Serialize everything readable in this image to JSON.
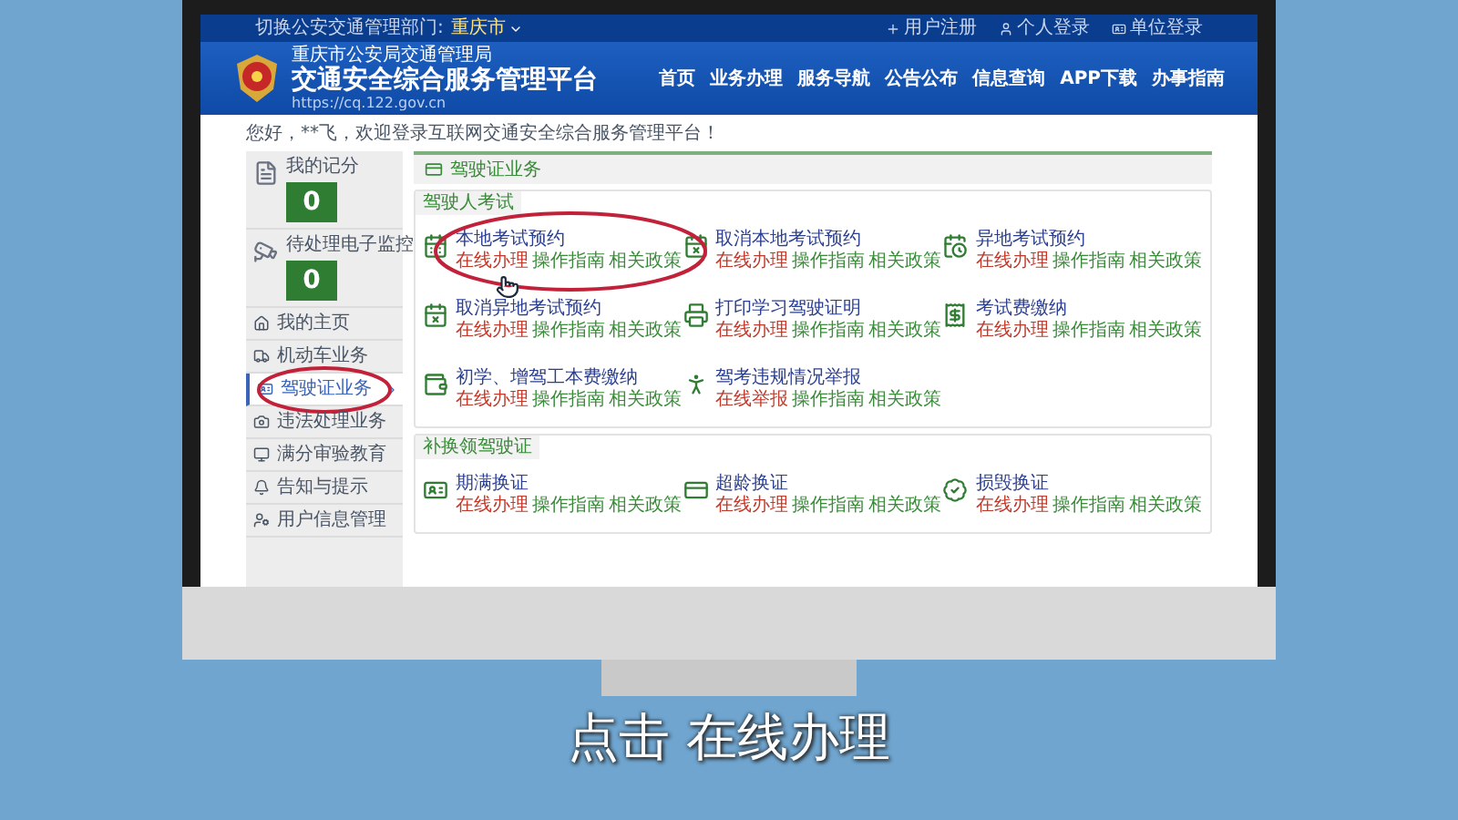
{
  "top_bar": {
    "switch_label": "切换公安交通管理部门:",
    "city": "重庆市",
    "links": [
      "用户注册",
      "个人登录",
      "单位登录"
    ]
  },
  "header": {
    "org": "重庆市公安局交通管理局",
    "title": "交通安全综合服务管理平台",
    "url": "https://cq.122.gov.cn",
    "nav": [
      "首页",
      "业务办理",
      "服务导航",
      "公告公布",
      "信息查询",
      "APP下载",
      "办事指南"
    ]
  },
  "greeting": "您好，**飞，欢迎登录互联网交通安全综合服务管理平台！",
  "sidebar": {
    "score_cards": [
      {
        "label": "我的记分",
        "value": "0"
      },
      {
        "label": "待处理电子监控",
        "value": "0"
      }
    ],
    "items": [
      {
        "label": "我的主页",
        "selected": false
      },
      {
        "label": "机动车业务",
        "selected": false
      },
      {
        "label": "驾驶证业务",
        "selected": true
      },
      {
        "label": "违法处理业务",
        "selected": false
      },
      {
        "label": "满分审验教育",
        "selected": false
      },
      {
        "label": "告知与提示",
        "selected": false
      },
      {
        "label": "用户信息管理",
        "selected": false
      }
    ]
  },
  "panel": {
    "title": "驾驶证业务",
    "sections": [
      {
        "title": "驾驶人考试",
        "services": [
          {
            "name": "本地考试预约",
            "links": [
              {
                "label": "在线办理",
                "kind": "primary"
              },
              {
                "label": "操作指南",
                "kind": "secondary"
              },
              {
                "label": "相关政策",
                "kind": "secondary"
              }
            ]
          },
          {
            "name": "取消本地考试预约",
            "links": [
              {
                "label": "在线办理",
                "kind": "primary"
              },
              {
                "label": "操作指南",
                "kind": "secondary"
              },
              {
                "label": "相关政策",
                "kind": "secondary"
              }
            ]
          },
          {
            "name": "异地考试预约",
            "links": [
              {
                "label": "在线办理",
                "kind": "primary"
              },
              {
                "label": "操作指南",
                "kind": "secondary"
              },
              {
                "label": "相关政策",
                "kind": "secondary"
              }
            ]
          },
          {
            "name": "取消异地考试预约",
            "links": [
              {
                "label": "在线办理",
                "kind": "primary"
              },
              {
                "label": "操作指南",
                "kind": "secondary"
              },
              {
                "label": "相关政策",
                "kind": "secondary"
              }
            ]
          },
          {
            "name": "打印学习驾驶证明",
            "links": [
              {
                "label": "在线办理",
                "kind": "primary"
              },
              {
                "label": "操作指南",
                "kind": "secondary"
              },
              {
                "label": "相关政策",
                "kind": "secondary"
              }
            ]
          },
          {
            "name": "考试费缴纳",
            "links": [
              {
                "label": "在线办理",
                "kind": "primary"
              },
              {
                "label": "操作指南",
                "kind": "secondary"
              },
              {
                "label": "相关政策",
                "kind": "secondary"
              }
            ]
          },
          {
            "name": "初学、增驾工本费缴纳",
            "links": [
              {
                "label": "在线办理",
                "kind": "primary"
              },
              {
                "label": "操作指南",
                "kind": "secondary"
              },
              {
                "label": "相关政策",
                "kind": "secondary"
              }
            ]
          },
          {
            "name": "驾考违规情况举报",
            "links": [
              {
                "label": "在线举报",
                "kind": "primary"
              },
              {
                "label": "操作指南",
                "kind": "secondary"
              },
              {
                "label": "相关政策",
                "kind": "secondary"
              }
            ]
          }
        ]
      },
      {
        "title": "补换领驾驶证",
        "services": [
          {
            "name": "期满换证",
            "links": [
              {
                "label": "在线办理",
                "kind": "primary"
              },
              {
                "label": "操作指南",
                "kind": "secondary"
              },
              {
                "label": "相关政策",
                "kind": "secondary"
              }
            ]
          },
          {
            "name": "超龄换证",
            "links": [
              {
                "label": "在线办理",
                "kind": "primary"
              },
              {
                "label": "操作指南",
                "kind": "secondary"
              },
              {
                "label": "相关政策",
                "kind": "secondary"
              }
            ]
          },
          {
            "name": "损毁换证",
            "links": [
              {
                "label": "在线办理",
                "kind": "primary"
              },
              {
                "label": "操作指南",
                "kind": "secondary"
              },
              {
                "label": "相关政策",
                "kind": "secondary"
              }
            ]
          }
        ]
      }
    ]
  },
  "subtitle": "点击 在线办理"
}
